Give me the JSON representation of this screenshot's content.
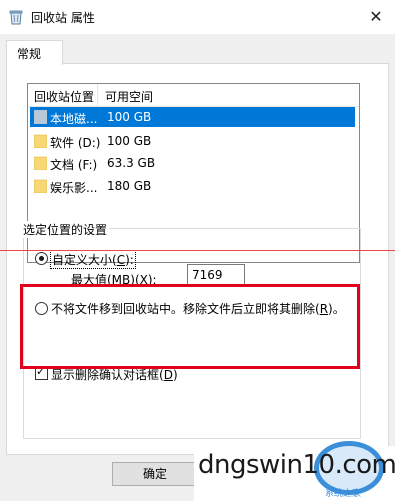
{
  "window": {
    "title": "回收站 属性",
    "close_glyph": "✕"
  },
  "tab": {
    "label": "常规"
  },
  "list": {
    "headers": [
      "回收站位置",
      "可用空间"
    ],
    "rows": [
      {
        "name": "本地磁...",
        "space": "100 GB",
        "icon": "drive-icon",
        "selected": true
      },
      {
        "name": "软件 (D:)",
        "space": "100 GB",
        "icon": "folder-icon"
      },
      {
        "name": "文档 (F:)",
        "space": "63.3 GB",
        "icon": "folder-icon"
      },
      {
        "name": "娱乐影...",
        "space": "180 GB",
        "icon": "folder-icon"
      }
    ]
  },
  "settings": {
    "group_label": "选定位置的设置",
    "custom_size": {
      "pre": "自定义大小(",
      "key": "C",
      "post": "):",
      "selected": true
    },
    "max_size": {
      "pre": "最大值(MB)(",
      "key": "X",
      "post": "):",
      "value": "7169"
    },
    "no_move": {
      "pre": "不将文件移到回收站中。移除文件后立即将其删除(",
      "key": "R",
      "post": ")。",
      "selected": false
    },
    "confirm": {
      "pre": "显示删除确认对话框(",
      "key": "D",
      "post": ")",
      "checked": true
    }
  },
  "buttons": {
    "ok": "确定"
  },
  "watermark": {
    "text": "dngswin10.com",
    "sub": "系统之家"
  },
  "colors": {
    "selection": "#0078d7",
    "highlight": "#e1001e",
    "folder": "#f8d775"
  }
}
